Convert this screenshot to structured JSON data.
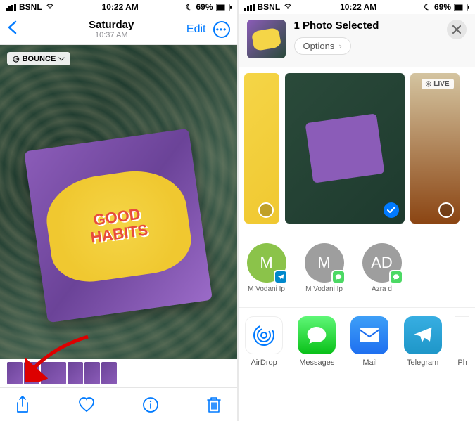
{
  "status": {
    "carrier": "BSNL",
    "time": "10:22 AM",
    "battery": "69%"
  },
  "left": {
    "nav": {
      "title": "Saturday",
      "subtitle": "10:37 AM",
      "edit_label": "Edit"
    },
    "bounce_label": "BOUNCE",
    "book_title_line1": "GOOD",
    "book_title_line2": "HABITS"
  },
  "right": {
    "share_title": "1 Photo Selected",
    "options_label": "Options",
    "live_badge": "LIVE",
    "contacts": [
      {
        "initial": "M",
        "name": "M Vodani Ip",
        "color": "green",
        "badge": "telegram"
      },
      {
        "initial": "M",
        "name": "M Vodani Ip",
        "color": "gray",
        "badge": "messages"
      },
      {
        "initial": "AD",
        "name": "Azra d",
        "color": "gray",
        "badge": "messages"
      }
    ],
    "apps": [
      {
        "label": "AirDrop"
      },
      {
        "label": "Messages"
      },
      {
        "label": "Mail"
      },
      {
        "label": "Telegram"
      },
      {
        "label": "Ph"
      }
    ]
  }
}
